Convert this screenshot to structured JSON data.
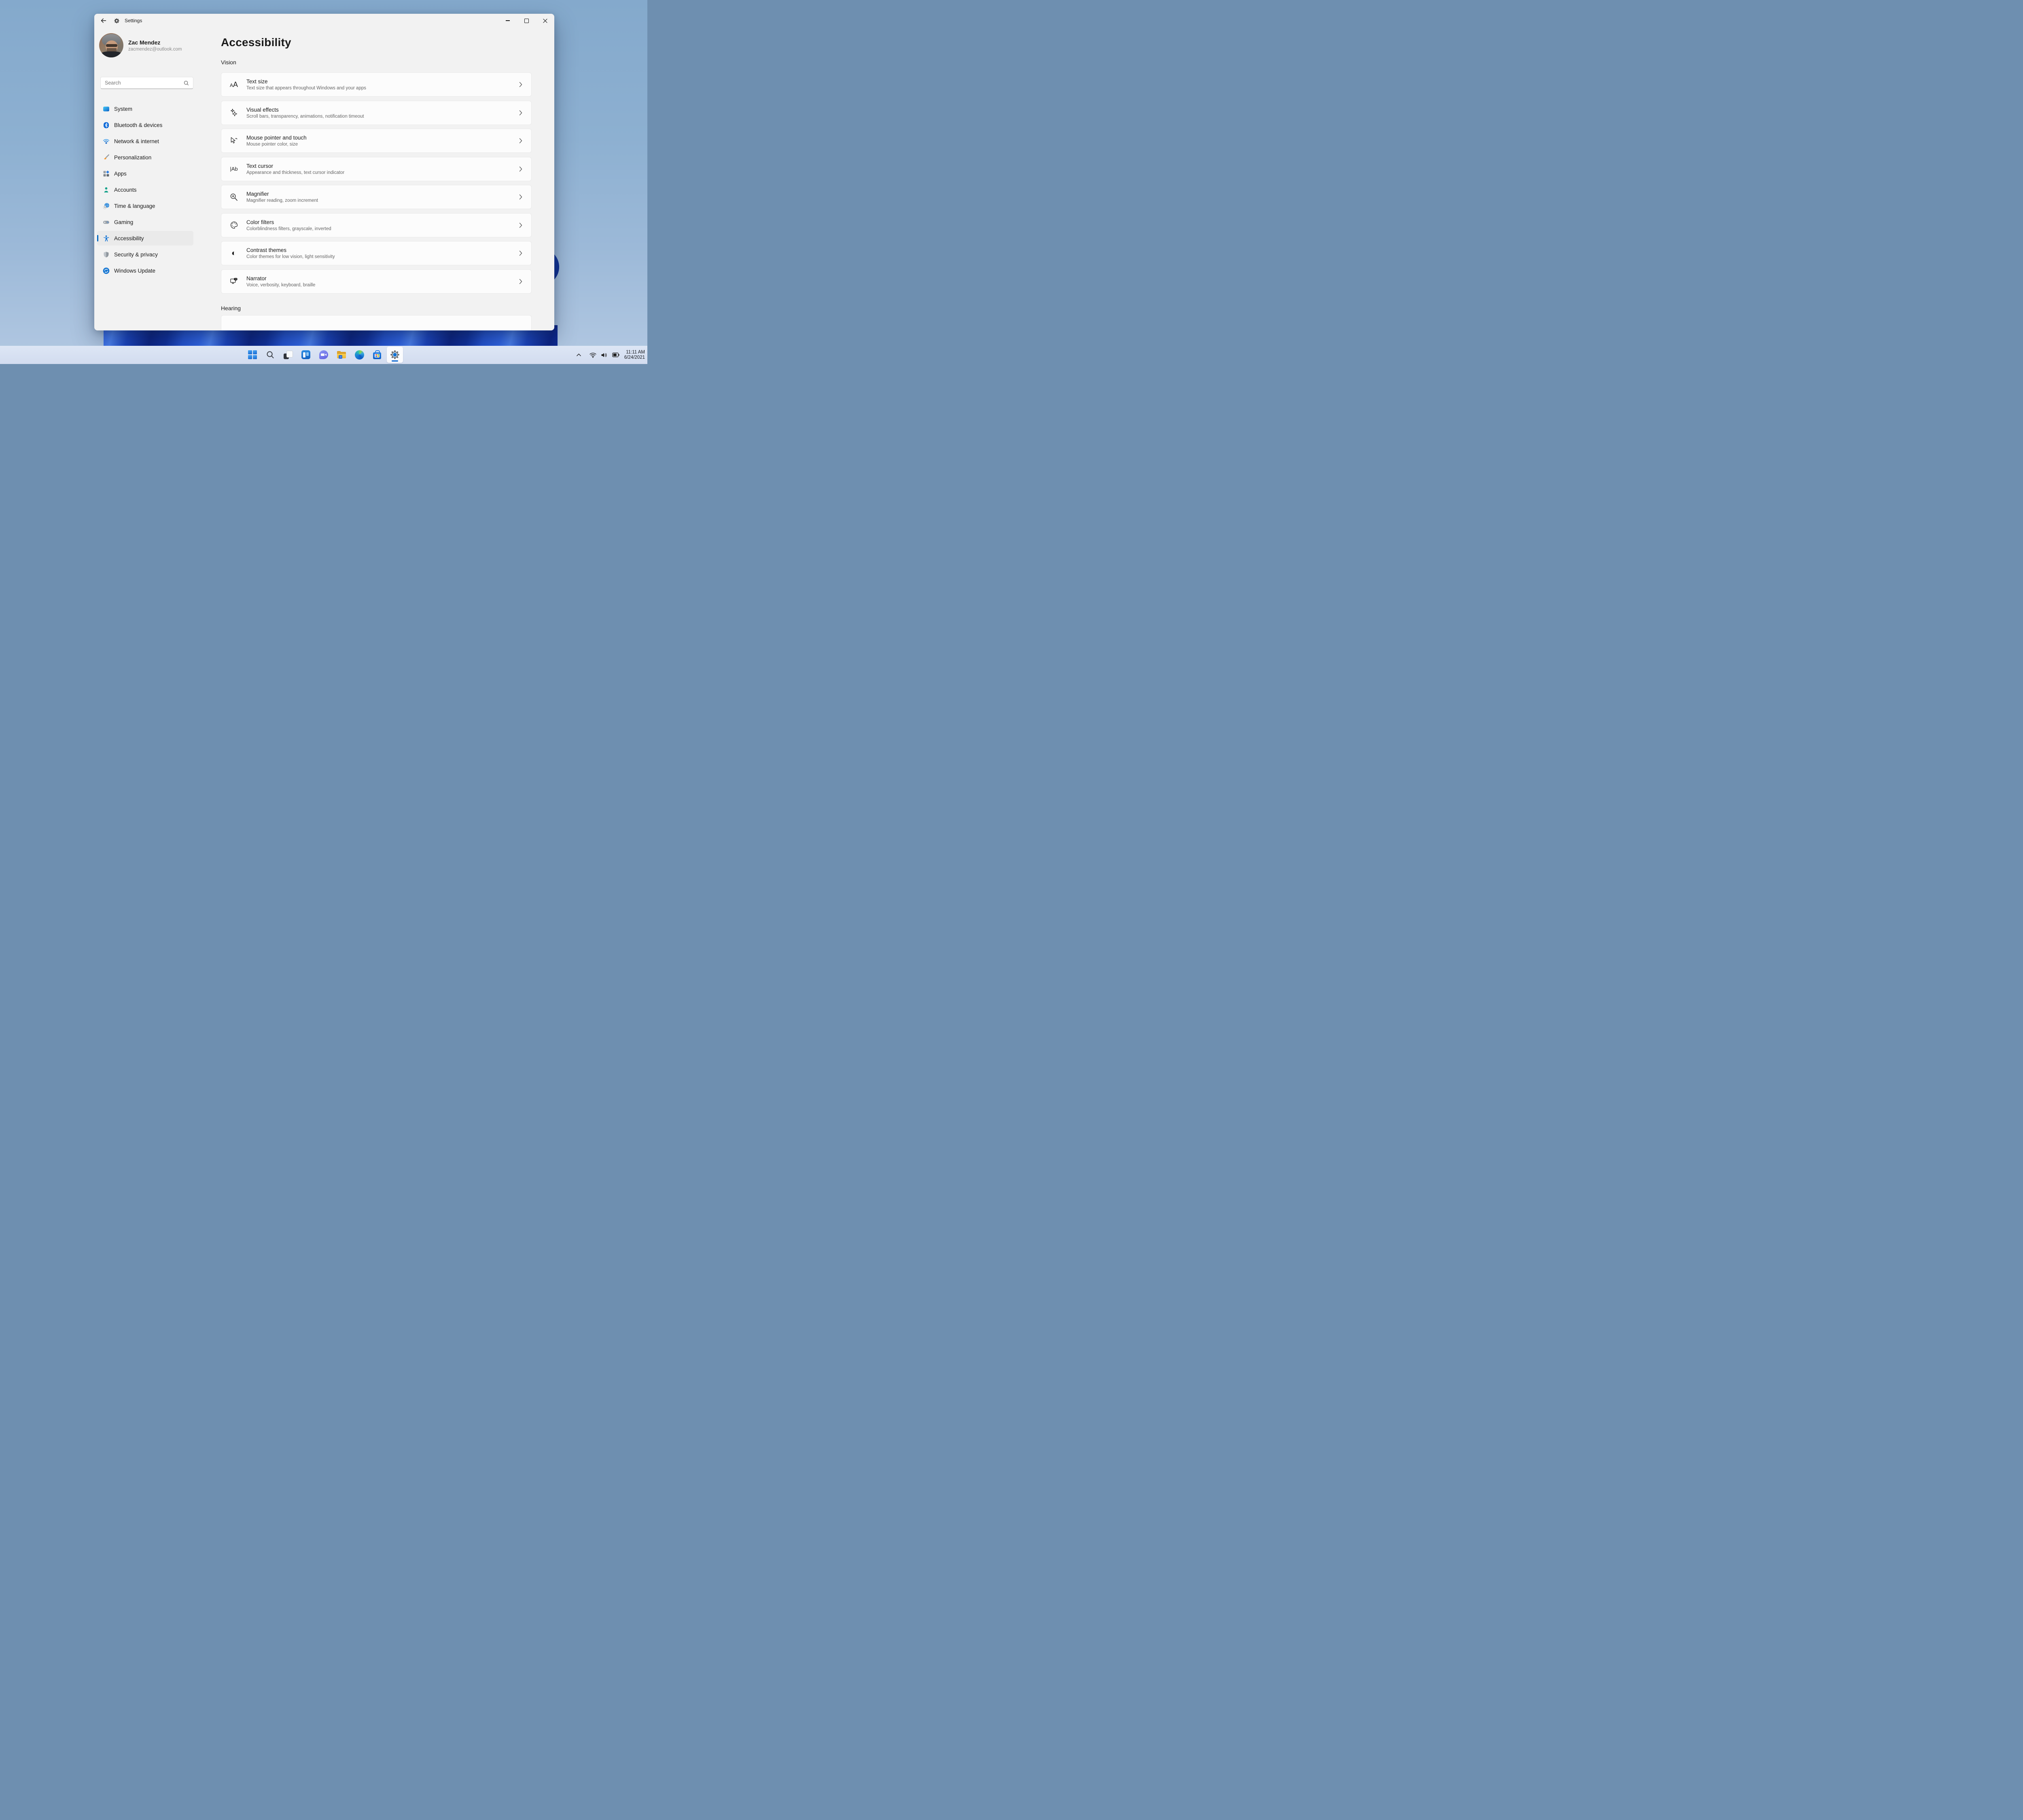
{
  "window": {
    "title": "Settings",
    "controls": {
      "minimize": "minimize",
      "maximize": "maximize",
      "close": "close"
    },
    "back": "back"
  },
  "profile": {
    "name": "Zac Mendez",
    "email": "zacmendez@outlook.com"
  },
  "search": {
    "placeholder": "Search"
  },
  "sidebar": {
    "items": [
      {
        "label": "System",
        "icon": "system-icon",
        "selected": false
      },
      {
        "label": "Bluetooth & devices",
        "icon": "bluetooth-icon",
        "selected": false
      },
      {
        "label": "Network & internet",
        "icon": "network-icon",
        "selected": false
      },
      {
        "label": "Personalization",
        "icon": "personalization-icon",
        "selected": false
      },
      {
        "label": "Apps",
        "icon": "apps-icon",
        "selected": false
      },
      {
        "label": "Accounts",
        "icon": "accounts-icon",
        "selected": false
      },
      {
        "label": "Time & language",
        "icon": "time-language-icon",
        "selected": false
      },
      {
        "label": "Gaming",
        "icon": "gaming-icon",
        "selected": false
      },
      {
        "label": "Accessibility",
        "icon": "accessibility-icon",
        "selected": true
      },
      {
        "label": "Security & privacy",
        "icon": "security-icon",
        "selected": false
      },
      {
        "label": "Windows Update",
        "icon": "windows-update-icon",
        "selected": false
      }
    ]
  },
  "main": {
    "title": "Accessibility",
    "sections": [
      {
        "label": "Vision"
      },
      {
        "label": "Hearing"
      }
    ],
    "rows": [
      {
        "title": "Text size",
        "subtitle": "Text size that appears throughout Windows and your apps",
        "icon": "text-size-icon"
      },
      {
        "title": "Visual effects",
        "subtitle": "Scroll bars, transparency, animations, notification timeout",
        "icon": "visual-effects-icon"
      },
      {
        "title": "Mouse pointer and touch",
        "subtitle": "Mouse pointer color, size",
        "icon": "mouse-pointer-icon"
      },
      {
        "title": "Text cursor",
        "subtitle": "Appearance and thickness, text cursor indicator",
        "icon": "text-cursor-icon"
      },
      {
        "title": "Magnifier",
        "subtitle": "Magnifier reading, zoom increment",
        "icon": "magnifier-icon"
      },
      {
        "title": "Color filters",
        "subtitle": "Colorblindness filters, grayscale, inverted",
        "icon": "color-filters-icon"
      },
      {
        "title": "Contrast themes",
        "subtitle": "Color themes for low vision, light sensitivity",
        "icon": "contrast-themes-icon"
      },
      {
        "title": "Narrator",
        "subtitle": "Voice, verbosity, keyboard, braille",
        "icon": "narrator-icon"
      }
    ],
    "text_cursor_glyph": "|Ab",
    "contrast_glyph": "◐",
    "text_size_glyph_small": "A",
    "text_size_glyph_large": "A"
  },
  "taskbar": {
    "icons": [
      {
        "name": "start-icon",
        "active": false
      },
      {
        "name": "search-taskbar-icon",
        "active": false
      },
      {
        "name": "task-view-icon",
        "active": false
      },
      {
        "name": "widgets-icon",
        "active": false
      },
      {
        "name": "chat-icon",
        "active": false
      },
      {
        "name": "file-explorer-icon",
        "active": false
      },
      {
        "name": "edge-icon",
        "active": false
      },
      {
        "name": "store-icon",
        "active": false
      },
      {
        "name": "settings-gear-icon",
        "active": true
      }
    ],
    "tray": {
      "time": "11:11 AM",
      "date": "6/24/2021"
    }
  },
  "colors": {
    "accent": "#0067c0",
    "selection_bg": "#eaeaea",
    "window_bg": "#f2f2f2",
    "card_bg": "#fcfcfc",
    "taskbar_bg": "#d5dff1",
    "wallpaper_light": "#8db0d1",
    "wallpaper_bloom": "#0d2d90"
  }
}
